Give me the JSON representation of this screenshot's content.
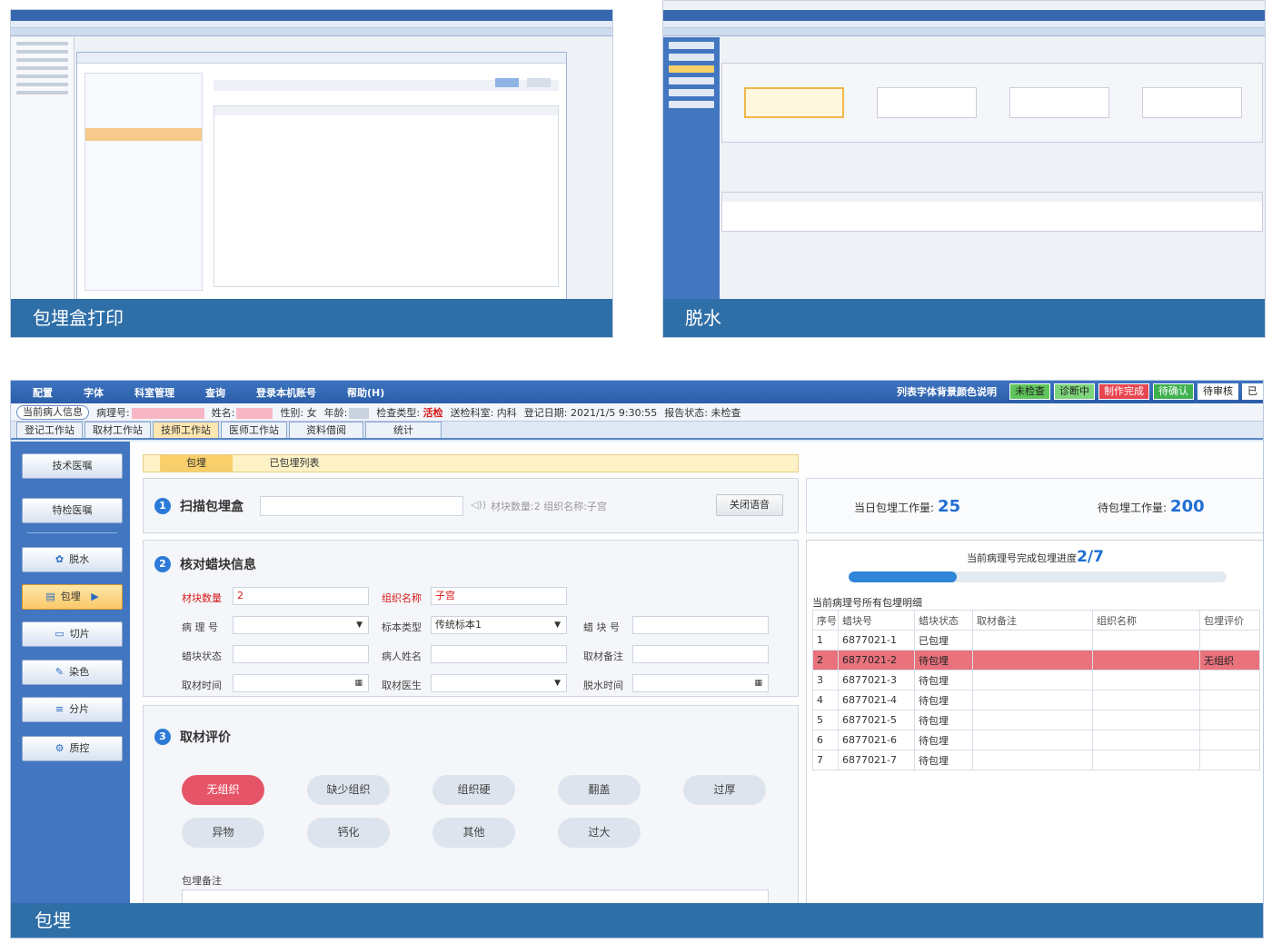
{
  "thumbnails": [
    {
      "caption": "包埋盒打印"
    },
    {
      "caption": "脱水"
    }
  ],
  "menu": [
    "配置",
    "字体",
    "科室管理",
    "查询",
    "登录本机账号",
    "帮助(H)"
  ],
  "status_legend": {
    "title": "列表字体背景颜色说明",
    "badges": [
      {
        "label": "未检查",
        "color": "#5fc45a"
      },
      {
        "label": "诊断中",
        "color": "#7ed47a"
      },
      {
        "label": "制作完成",
        "color": "#e8454f"
      },
      {
        "label": "待确认",
        "color": "#3fb14f"
      },
      {
        "label": "待审核",
        "color": "#ffffff"
      },
      {
        "label": "已",
        "color": "#ffffff"
      }
    ]
  },
  "patient_info": {
    "current_label": "当前病人信息",
    "case_no_label": "病理号:",
    "name_label": "姓名:",
    "sex": "性别: 女",
    "age_label": "年龄:",
    "exam_type_label": "检查类型:",
    "exam_type": "活检",
    "dept": "送检科室: 内科",
    "reg_date": "登记日期: 2021/1/5 9:30:55",
    "report_status": "报告状态: 未检查"
  },
  "main_tabs": [
    "登记工作站",
    "取材工作站",
    "技师工作站",
    "医师工作站",
    "资料借阅",
    "统计"
  ],
  "sidebar": [
    {
      "label": "技术医嘱",
      "icon": ""
    },
    {
      "label": "特检医嘱",
      "icon": ""
    },
    {
      "label": "脱水",
      "icon": "✿"
    },
    {
      "label": "包埋",
      "icon": "▤",
      "arrow": "▶"
    },
    {
      "label": "切片",
      "icon": "▭"
    },
    {
      "label": "染色",
      "icon": "✎"
    },
    {
      "label": "分片",
      "icon": "≡"
    },
    {
      "label": "质控",
      "icon": "⚙"
    }
  ],
  "sub_tabs": [
    "包埋",
    "已包埋列表"
  ],
  "scan": {
    "num": "1",
    "title": "扫描包埋盒",
    "hint": "材块数量:2  组织名称:子宫",
    "close_sound": "关闭语音"
  },
  "verify": {
    "num": "2",
    "title": "核对蜡块信息",
    "fields": {
      "block_count_label": "材块数量",
      "block_count": "2",
      "tissue_name_label": "组织名称",
      "tissue_name": "子宫",
      "case_no_label": "病 理 号",
      "sample_type_label": "标本类型",
      "sample_type": "传统标本1",
      "block_no_label": "蜡 块 号",
      "block_status_label": "蜡块状态",
      "patient_name_label": "病人姓名",
      "grossing_note_label": "取材备注",
      "grossing_time_label": "取材时间",
      "grossing_doctor_label": "取材医生",
      "dehydration_time_label": "脱水时间"
    }
  },
  "evaluation": {
    "num": "3",
    "title": "取材评价",
    "options": [
      "无组织",
      "缺少组织",
      "组织硬",
      "翻盖",
      "过厚",
      "异物",
      "钙化",
      "其他",
      "过大"
    ],
    "active": "无组织",
    "note_label": "包埋备注"
  },
  "stats": {
    "today_label": "当日包埋工作量:",
    "today_value": "25",
    "pending_label": "待包埋工作量:",
    "pending_value": "200"
  },
  "progress": {
    "label": "当前病理号完成包埋进度",
    "value": "2/7",
    "fraction": 0.2857
  },
  "detail": {
    "title": "当前病理号所有包埋明细",
    "columns": [
      "序号",
      "蜡块号",
      "蜡块状态",
      "取材备注",
      "组织名称",
      "包埋评价"
    ],
    "rows": [
      [
        "1",
        "6877021-1",
        "已包埋",
        "",
        "",
        ""
      ],
      [
        "2",
        "6877021-2",
        "待包埋",
        "",
        "",
        "无组织"
      ],
      [
        "3",
        "6877021-3",
        "待包埋",
        "",
        "",
        ""
      ],
      [
        "4",
        "6877021-4",
        "待包埋",
        "",
        "",
        ""
      ],
      [
        "5",
        "6877021-5",
        "待包埋",
        "",
        "",
        ""
      ],
      [
        "6",
        "6877021-6",
        "待包埋",
        "",
        "",
        ""
      ],
      [
        "7",
        "6877021-7",
        "待包埋",
        "",
        "",
        ""
      ]
    ],
    "highlight_row": 1
  },
  "footer_caption": "包埋"
}
